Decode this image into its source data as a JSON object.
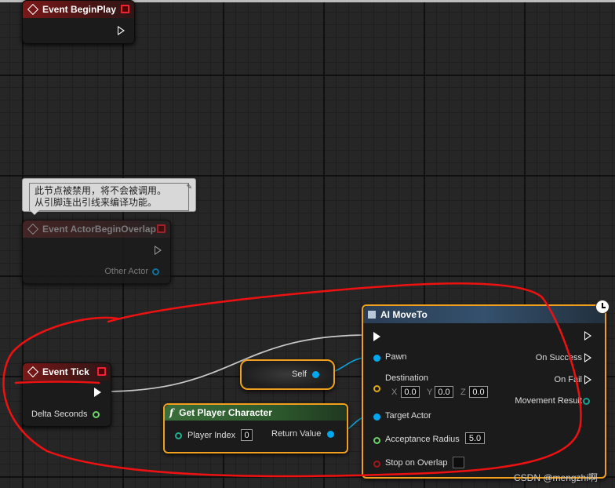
{
  "colors": {
    "exec": "#ffffff",
    "object_pin": "#00a8f0",
    "vector_pin": "#e0a818",
    "bool_pin": "#a01818",
    "float_pin": "#6ad66a",
    "wire_exec": "#c8c8c8",
    "wire_object": "#0fa0d8",
    "selection": "#f0a01c",
    "annotation": "#ee1111"
  },
  "nodes": {
    "begin_play": {
      "title": "Event BeginPlay"
    },
    "begin_overlap": {
      "title": "Event ActorBeginOverlap",
      "pin_other_actor": "Other Actor",
      "disabled_tooltip_line1": "此节点被禁用，将不会被调用。",
      "disabled_tooltip_line2": "从引脚连出引线来编译功能。"
    },
    "event_tick": {
      "title": "Event Tick",
      "pin_delta_seconds": "Delta Seconds"
    },
    "self": {
      "label": "Self"
    },
    "get_player_character": {
      "title": "Get Player Character",
      "func_icon": "f",
      "pin_player_index": "Player Index",
      "player_index_value": "0",
      "pin_return_value": "Return Value"
    },
    "ai_moveto": {
      "title": "AI MoveTo",
      "pin_pawn": "Pawn",
      "pin_destination": "Destination",
      "dest_x_label": "X",
      "dest_x": "0.0",
      "dest_y_label": "Y",
      "dest_y": "0.0",
      "dest_z_label": "Z",
      "dest_z": "0.0",
      "pin_target_actor": "Target Actor",
      "pin_acceptance_radius": "Acceptance Radius",
      "acceptance_radius_value": "5.0",
      "pin_stop_on_overlap": "Stop on Overlap",
      "pin_on_success": "On Success",
      "pin_on_fail": "On Fail",
      "pin_movement_result": "Movement Result"
    }
  },
  "watermark": "CSDN @mengzhi啊"
}
